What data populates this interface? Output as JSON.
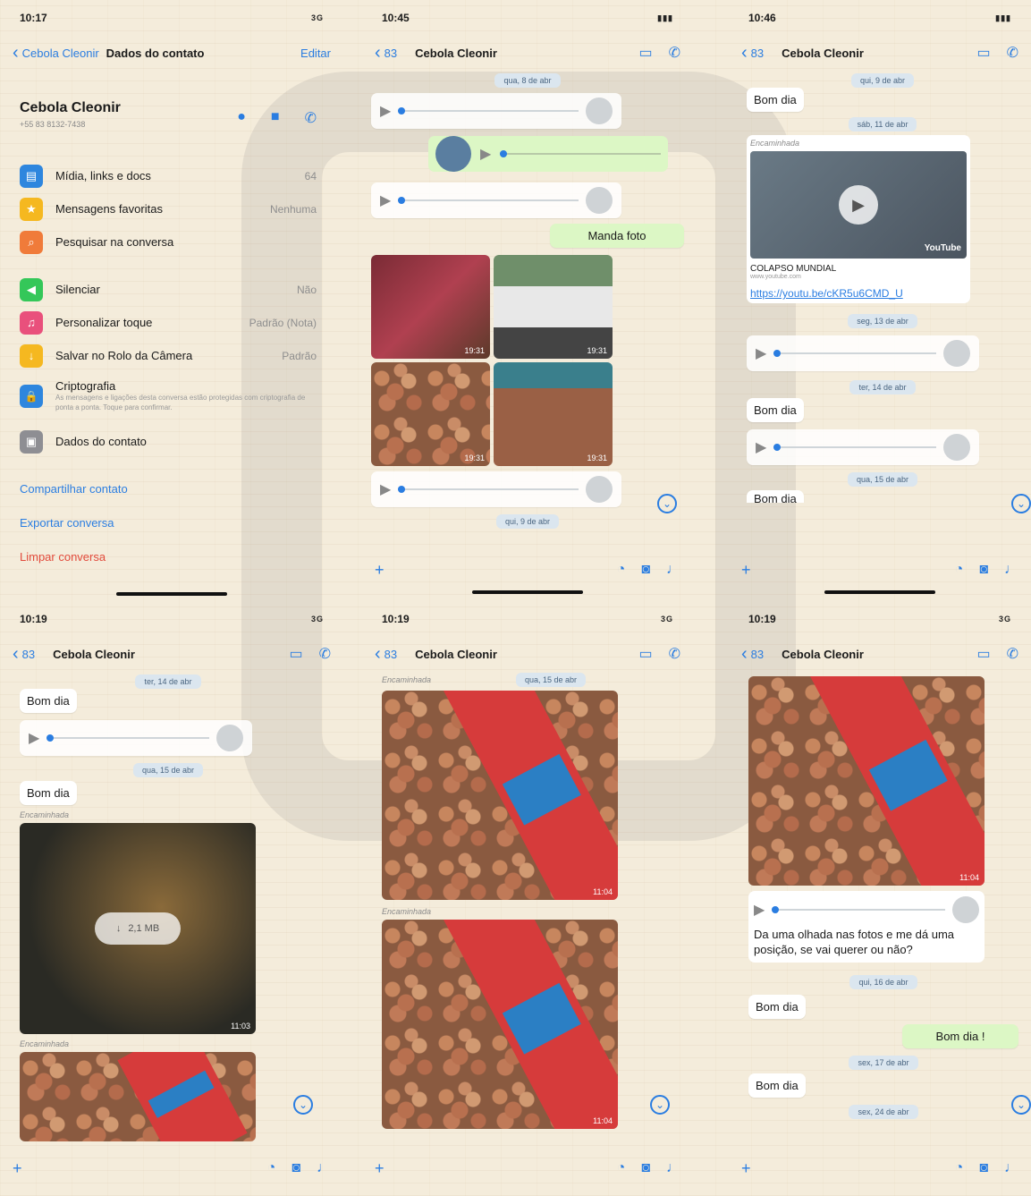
{
  "panels": {
    "p1": {
      "time": "10:17",
      "signal": "3G",
      "back": "Cebola Cleonir",
      "title": "Dados do contato",
      "edit": "Editar",
      "contact_name": "Cebola Cleonir",
      "contact_phone": "+55 83 8132-7438",
      "rows": [
        {
          "label": "Mídia, links e docs",
          "value": "64",
          "color": "#2e86de",
          "icon": "M"
        },
        {
          "label": "Mensagens favoritas",
          "value": "Nenhuma",
          "color": "#f5b820",
          "icon": "★"
        },
        {
          "label": "Pesquisar na conversa",
          "value": "",
          "color": "#f07b3a",
          "icon": "Q"
        },
        {
          "label": "Silenciar",
          "value": "Não",
          "color": "#34c759",
          "icon": "♪"
        },
        {
          "label": "Personalizar toque",
          "value": "Padrão (Nota)",
          "color": "#e9507c",
          "icon": "♫"
        },
        {
          "label": "Salvar no Rolo da Câmera",
          "value": "Padrão",
          "color": "#f5b820",
          "icon": "↓"
        }
      ],
      "crypto_title": "Criptografia",
      "crypto_desc": "As mensagens e ligações desta conversa estão protegidas com criptografia de ponta a ponta. Toque para confirmar.",
      "contact_data": "Dados do contato",
      "share": "Compartilhar contato",
      "export": "Exportar conversa",
      "clear": "Limpar conversa"
    },
    "p2": {
      "time": "10:45",
      "back_count": "83",
      "name": "Cebola Cleonir",
      "date1": "qua, 8 de abr",
      "msg_manda": "Manda foto",
      "photo_times": [
        "19:31",
        "19:31",
        "19:31",
        "19:31"
      ],
      "date2": "qui, 9 de abr"
    },
    "p3": {
      "time": "10:46",
      "back_count": "83",
      "name": "Cebola Cleonir",
      "date1": "qui, 9 de abr",
      "msg1": "Bom dia",
      "date2": "sáb, 11 de abr",
      "forwarded": "Encaminhada",
      "video_title": "COLAPSO MUNDIAL",
      "video_site": "www.youtube.com",
      "video_brand": "YouTube",
      "video_link": "https://youtu.be/cKR5u6CMD_U",
      "date3": "seg, 13 de abr",
      "date4": "ter, 14 de abr",
      "msg2": "Bom dia",
      "date5": "qua, 15 de abr",
      "msg3": "Bom dia"
    },
    "p4": {
      "time": "10:19",
      "signal": "3G",
      "back_count": "83",
      "name": "Cebola Cleonir",
      "date1": "ter, 14 de abr",
      "msg1": "Bom dia",
      "date2": "qua, 15 de abr",
      "msg2": "Bom dia",
      "forwarded": "Encaminhada",
      "download_size": "2,1 MB",
      "photo_time": "11:03",
      "forwarded2": "Encaminhada"
    },
    "p5": {
      "time": "10:19",
      "signal": "3G",
      "back_count": "83",
      "name": "Cebola Cleonir",
      "forwarded": "Encaminhada",
      "date1": "qua, 15 de abr",
      "photo_time1": "11:04",
      "forwarded2": "Encaminhada",
      "photo_time2": "11:04"
    },
    "p6": {
      "time": "10:19",
      "signal": "3G",
      "back_count": "83",
      "name": "Cebola Cleonir",
      "photo_time": "11:04",
      "msg_long": "Da uma olhada nas fotos e me dá uma posição, se vai querer ou não?",
      "date1": "qui, 16 de abr",
      "msg1": "Bom dia",
      "msg_out": "Bom dia !",
      "date2": "sex, 17 de abr",
      "msg2": "Bom dia",
      "date3": "sex, 24 de abr"
    }
  }
}
